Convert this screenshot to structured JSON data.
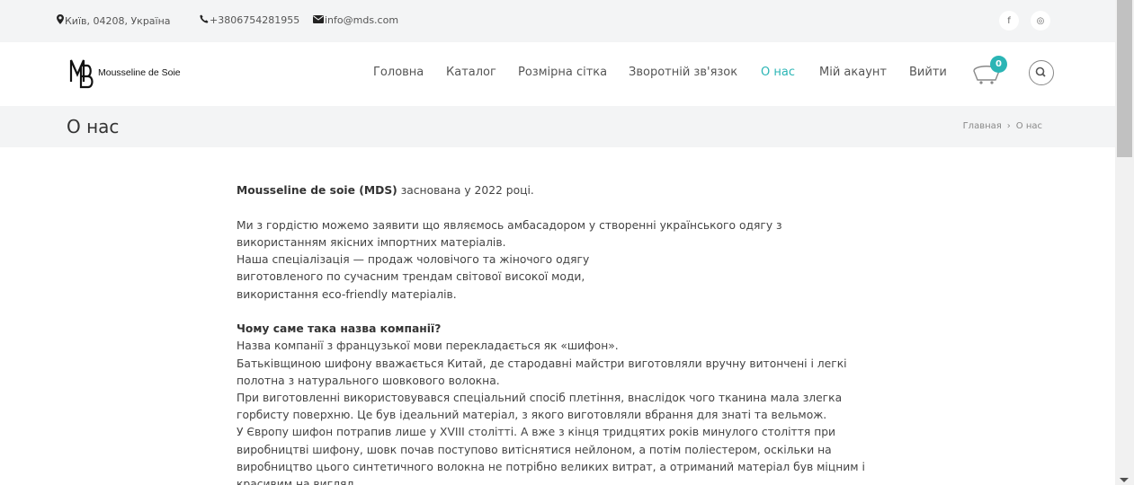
{
  "topbar": {
    "address": "Київ, 04208, Україна",
    "phone": "+3806754281955",
    "email": "info@mds.com",
    "social": [
      "f",
      "◎"
    ]
  },
  "header": {
    "logo_text": "Mousseline de Soie",
    "nav": [
      {
        "label": "Головна",
        "active": false
      },
      {
        "label": "Каталог",
        "active": false
      },
      {
        "label": "Розмірна сітка",
        "active": false
      },
      {
        "label": "Зворотній зв'язок",
        "active": false
      },
      {
        "label": "О нас",
        "active": true
      },
      {
        "label": "Мій акаунт",
        "active": false
      },
      {
        "label": "Вийти",
        "active": false
      }
    ],
    "cart_count": "0"
  },
  "titlebar": {
    "title": "О нас",
    "breadcrumb_home": "Главная",
    "breadcrumb_sep": "›",
    "breadcrumb_current": "О нас"
  },
  "content": {
    "intro_bold": "Mousseline de soie (MDS)",
    "intro_rest": " заснована у 2022 році.",
    "para2": [
      "Ми з гордістю можемо заявити що являємось амбасадором у створенні українського одягу з",
      "використанням якісних імпортних матеріалів.",
      "Наша спеціалізація — продаж чоловічого та жіночого одягу",
      "виготовленого по сучасним трендам світової високої моди,",
      "використання eco-friendly матеріалів."
    ],
    "question": "Чому саме така назва компанії?",
    "para3": [
      "Назва компанії з французької мови перекладається як «шифон».",
      "Батьківщиною шифону вважається Китай, де стародавні майстри виготовляли вручну витончені і легкі",
      "полотна з натурального шовкового волокна.",
      "При виготовленні використовувався спеціальний спосіб плетіння, внаслідок чого тканина мала злегка",
      "горбисту поверхню. Це був ідеальний матеріал, з якого виготовляли вбрання для знаті та вельмож.",
      "У Європу шифон потрапив лише у XVIII столітті. А вже з кінця тридцятих років минулого століття при",
      "виробництві шифону, шовк почав поступово витіснятися нейлоном, а потім поліестером, оскільки на",
      "виробництво цього синтетичного волокна не потрібно великих витрат, а отриманий матеріал був міцним і",
      "красивим на вигляд."
    ]
  },
  "colors": {
    "accent": "#2bb5b5",
    "topbar_bg": "#f3f4f5",
    "text": "#444444"
  }
}
